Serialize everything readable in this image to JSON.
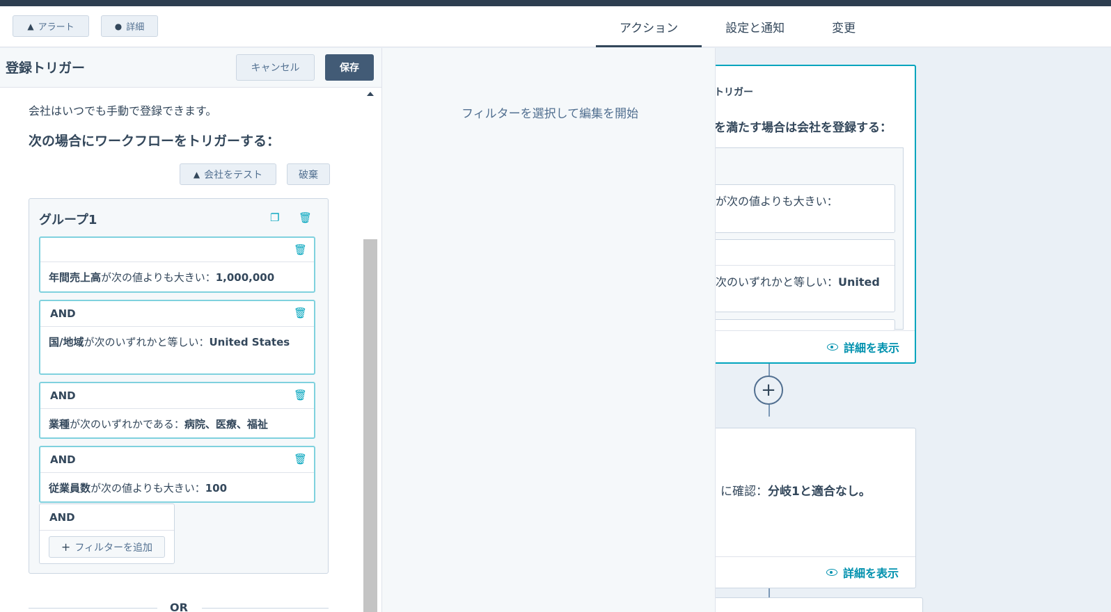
{
  "toolbar": {
    "alert_label": "アラート",
    "detail_label": "詳細"
  },
  "tabs": [
    "アクション",
    "設定と通知",
    "変更"
  ],
  "canvas": {
    "card1": {
      "heading": "トリガー",
      "condition": "を満たす場合は会社を登録する：",
      "inner1": "が次の値よりも大きい：",
      "inner2_prefix": "次のいずれかと等しい：",
      "inner2_value": "United",
      "view_label": "詳細を表示"
    },
    "card2": {
      "text_prefix": "に確認：",
      "text_value": "分岐1と適合なし。",
      "view_label": "詳細を表示"
    }
  },
  "middle": {
    "message": "フィルターを選択して編集を開始"
  },
  "left_panel": {
    "title": "登録トリガー",
    "cancel_label": "キャンセル",
    "save_label": "保存",
    "info": "会社はいつでも手動で登録できます。",
    "subtitle": "次の場合にワークフローをトリガーする：",
    "test_label": "会社をテスト",
    "discard_label": "破棄",
    "group": {
      "title": "グループ1",
      "filters": [
        {
          "and": "",
          "prop": "年間売上高",
          "op": "が次の値よりも大きい：",
          "value": "1,000,000"
        },
        {
          "and": "AND",
          "prop": "国/地域",
          "op": "が次のいずれかと等しい：",
          "value": "United States"
        },
        {
          "and": "AND",
          "prop": "業種",
          "op": "が次のいずれかである：",
          "value": "病院、医療、福祉"
        },
        {
          "and": "AND",
          "prop": "従業員数",
          "op": "が次の値よりも大きい：",
          "value": "100"
        }
      ],
      "add_and": "AND",
      "add_filter_label": "フィルターを追加"
    },
    "or_label": "OR"
  }
}
